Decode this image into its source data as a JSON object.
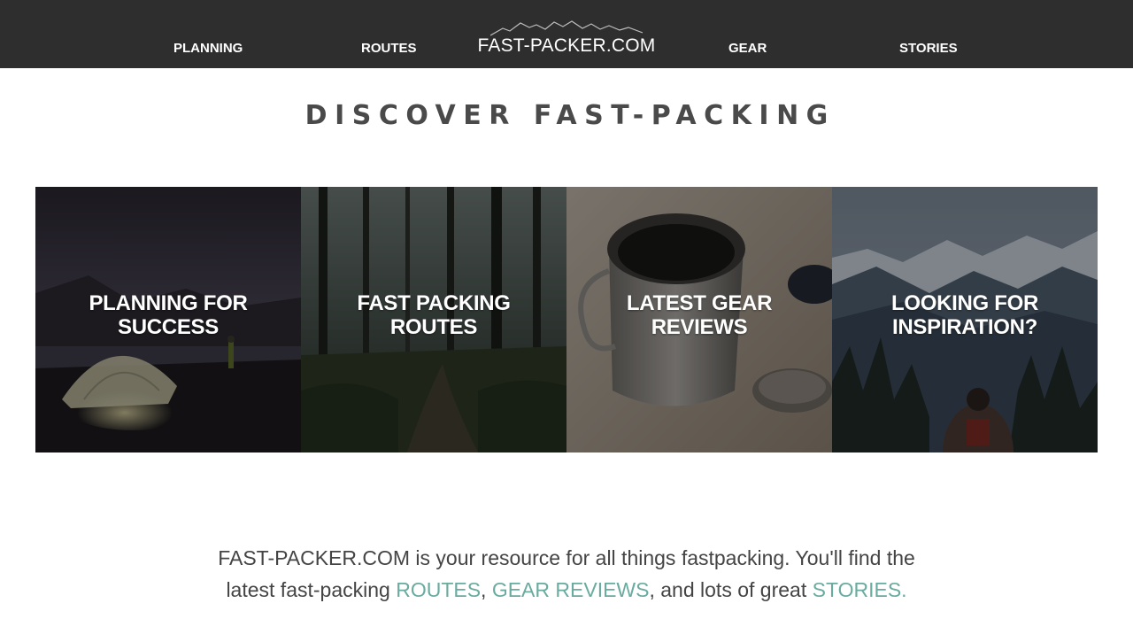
{
  "colors": {
    "topbar_bg": "#2e2e2e",
    "accent_link": "#6aaba0",
    "heading": "#4a4a4a",
    "body_text": "#444444"
  },
  "nav": {
    "left_items": [
      {
        "label": "PLANNING"
      },
      {
        "label": "ROUTES"
      }
    ],
    "logo": {
      "text": "FAST-PACKER.COM",
      "icon": "mountain-range-icon"
    },
    "right_items": [
      {
        "label": "GEAR"
      },
      {
        "label": "STORIES"
      }
    ]
  },
  "heading": "DISCOVER FAST-PACKING",
  "tiles": [
    {
      "label": "PLANNING FOR\nSUCCESS",
      "image": "tent-at-night-image"
    },
    {
      "label": "FAST PACKING\nROUTES",
      "image": "forest-trail-image"
    },
    {
      "label": "LATEST GEAR\nREVIEWS",
      "image": "camp-mug-image"
    },
    {
      "label": "LOOKING FOR\nINSPIRATION?",
      "image": "mountain-hiker-image"
    }
  ],
  "intro": {
    "line1": "FAST-PACKER.COM is your resource for all things fastpacking. You'll find the",
    "line2_prefix": "latest fast-packing ",
    "link_routes": "ROUTES",
    "sep1": ", ",
    "link_gear": "GEAR REVIEWS",
    "sep2": ", and lots of great ",
    "link_stories": "STORIES."
  }
}
